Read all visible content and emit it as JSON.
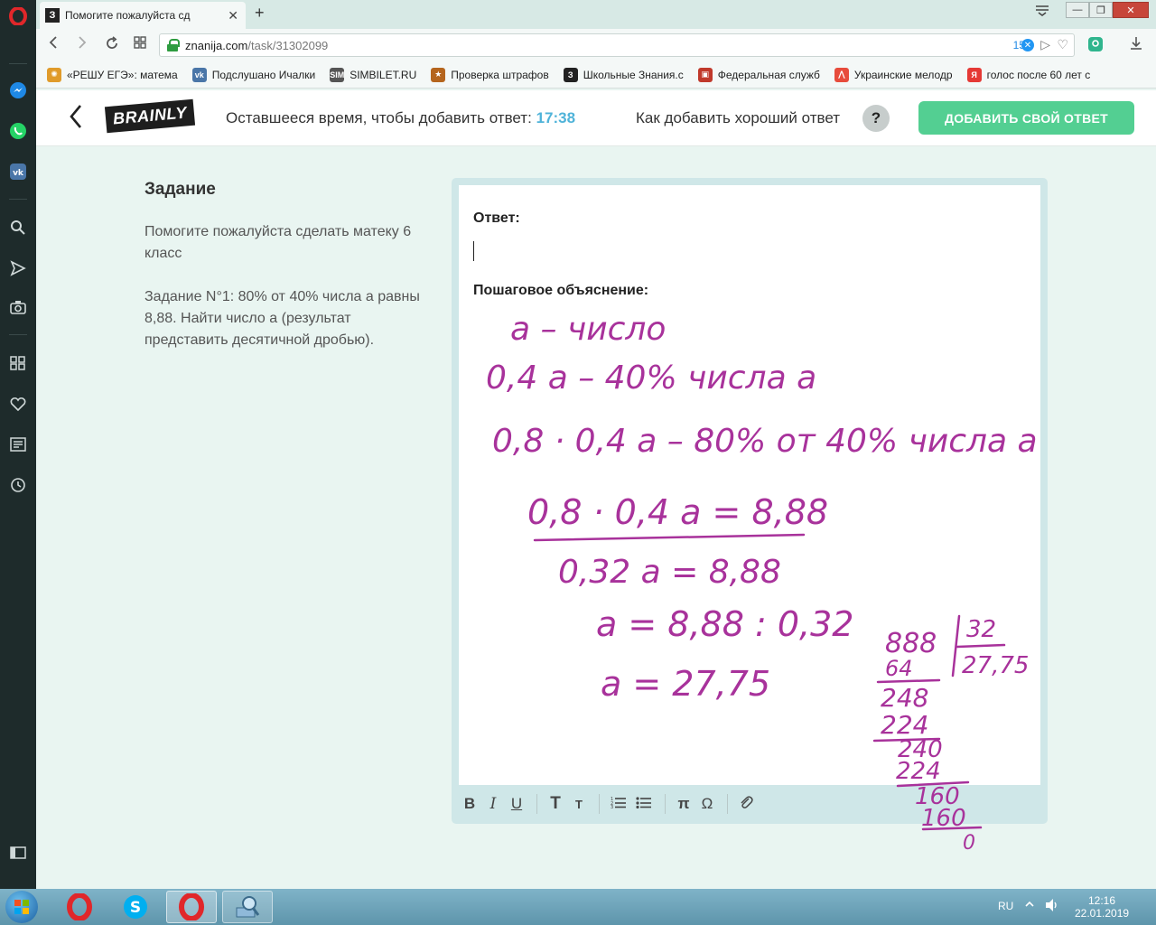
{
  "browser": {
    "tab_title": "Помогите пожалуйста сд",
    "tab_favicon": "З",
    "url_host": "znanija.com",
    "url_path": "/task/31302099",
    "badge_count": "15",
    "bookmarks": [
      {
        "label": "«РЕШУ ЕГЭ»: матема",
        "icon": "gear-icon",
        "color": "#e09b2a",
        "glyph": "✺"
      },
      {
        "label": "Подслушано Ичалки",
        "icon": "vk-icon",
        "color": "#4a76a8",
        "glyph": "vk"
      },
      {
        "label": "SIMBILET.RU",
        "icon": "sim-icon",
        "color": "#555555",
        "glyph": "SIM"
      },
      {
        "label": "Проверка штрафов",
        "icon": "emblem-icon",
        "color": "#b5651d",
        "glyph": "★"
      },
      {
        "label": "Школьные Знания.c",
        "icon": "znanija-icon",
        "color": "#222222",
        "glyph": "З"
      },
      {
        "label": "Федеральная служб",
        "icon": "fed-icon",
        "color": "#c0392b",
        "glyph": "▣"
      },
      {
        "label": "Украинские мелодр",
        "icon": "chart-icon",
        "color": "#e74c3c",
        "glyph": "⋀"
      },
      {
        "label": "голос после 60 лет с",
        "icon": "yandex-icon",
        "color": "#e53935",
        "glyph": "Я"
      }
    ]
  },
  "header": {
    "logo": "BRAINLY",
    "time_label": "Оставшееся время, чтобы добавить ответ:",
    "time_value": "17:38",
    "howto": "Как добавить хороший ответ",
    "help": "?",
    "add_answer": "ДОБАВИТЬ СВОЙ ОТВЕТ"
  },
  "task": {
    "heading": "Задание",
    "line1": "Помогите пожалуйста сделать матеку 6 класс",
    "line2": "Задание N°1: 80% от 40% числа a равны 8,88. Найти число a (результат представить десятичной дробью)."
  },
  "editor": {
    "answer_label": "Ответ:",
    "explain_label": "Пошаговое объяснение:",
    "toolbar": {
      "bold": "B",
      "italic": "I",
      "underline": "U",
      "text_big": "T",
      "text_small": "T",
      "pi": "π",
      "omega": "Ω"
    }
  },
  "handwriting": {
    "color": "#a8329b",
    "lines": [
      "a – число",
      "0,4 a   – 40% числа  a",
      "0,8 · 0,4 a   – 80% от 40% числа a",
      "0,8 · 0,4 a = 8,88",
      "0,32 a = 8,88",
      "a = 8,88 : 0,32",
      "a = 27,75"
    ],
    "division": {
      "dividend": "888",
      "divisor": "32",
      "quotient": "27,75",
      "steps": [
        "64",
        "248",
        "224",
        "240",
        "224",
        "160",
        "160",
        "0"
      ]
    }
  },
  "taskbar": {
    "lang": "RU",
    "time": "12:16",
    "date": "22.01.2019"
  }
}
